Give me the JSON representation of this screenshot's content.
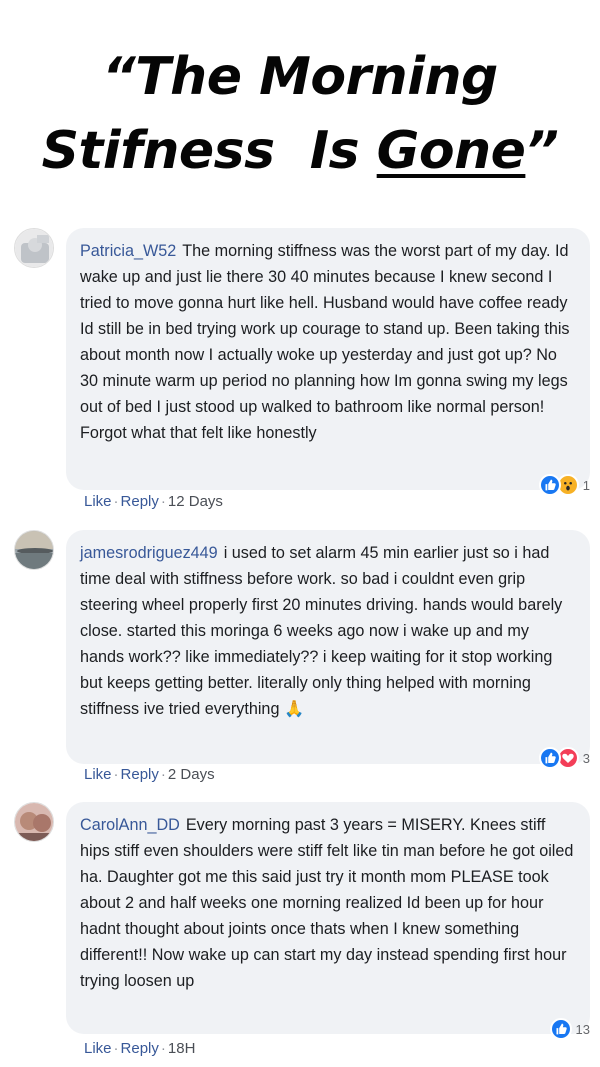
{
  "headline": {
    "line1": "“The Morning",
    "line2_start": "Stifness  Is ",
    "line2_underlined": "Gone",
    "line2_end": "”"
  },
  "comments": [
    {
      "author": "Patricia_W52",
      "text": "The morning stiffness was the worst part of my day. Id wake up and just lie there 30 40 minutes because I knew second I tried to move gonna hurt like hell. Husband would have coffee ready Id still be in bed trying work up courage to stand up. Been taking this about month now I actually woke up yesterday and just got up? No 30 minute warm up period no planning how Im gonna swing my legs out of bed I just stood up walked to bathroom like normal person! Forgot what that felt like honestly",
      "like_label": "Like",
      "reply_label": "Reply",
      "time": "12 Days",
      "reaction_count": "1",
      "reactions": [
        "like",
        "wow"
      ]
    },
    {
      "author": "jamesrodriguez449",
      "text": "i used to set alarm 45 min earlier just so i had time deal with stiffness before work. so bad i couldnt even grip steering wheel properly first 20 minutes driving. hands would barely close. started this moringa 6 weeks ago now i wake up and my hands work?? like immediately?? i keep waiting for it stop working but keeps getting better. literally only thing helped with morning stiffness ive tried everything 🙏",
      "like_label": "Like",
      "reply_label": "Reply",
      "time": "2 Days",
      "reaction_count": "3",
      "reactions": [
        "like",
        "love"
      ]
    },
    {
      "author": "CarolAnn_DD",
      "text": "Every morning past 3 years = MISERY. Knees stiff hips stiff even shoulders were stiff felt like tin man before he got oiled ha. Daughter got me this said just try it month mom PLEASE took about 2 and half weeks one morning realized Id been up for hour hadnt thought about joints once thats when I knew something different!! Now wake up can start my day instead spending first hour trying loosen up",
      "like_label": "Like",
      "reply_label": "Reply",
      "time": "18H",
      "reaction_count": "13",
      "reactions": [
        "like"
      ]
    }
  ],
  "colors": {
    "link": "#385898",
    "bubble": "#f0f2f5",
    "like_reaction": "#1877f2",
    "love_reaction": "#f33e58",
    "wow_reaction": "#f7b125"
  },
  "icons": {
    "like": "thumbs-up-icon",
    "love": "heart-icon",
    "wow": "wow-face-icon"
  }
}
